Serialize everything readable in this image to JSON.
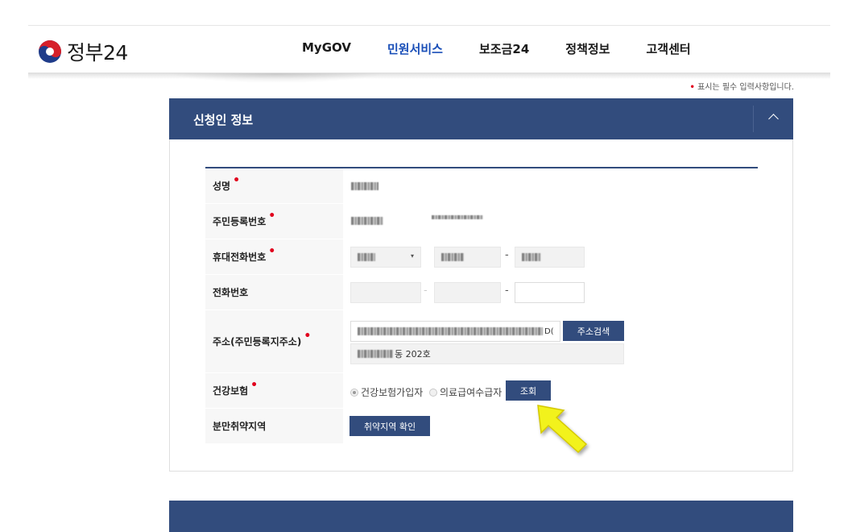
{
  "header": {
    "logo_text": "정부24",
    "nav": [
      "MyGOV",
      "민원서비스",
      "보조금24",
      "정책정보",
      "고객센터"
    ],
    "active_nav_index": 1
  },
  "required_note": "표시는 필수 입력사항입니다.",
  "panel": {
    "title": "신청인 정보",
    "toggle_icon": "chevron-up-icon"
  },
  "form": {
    "name_label": "성명",
    "rrn_label": "주민등록번호",
    "mobile_label": "휴대전화번호",
    "phone_label": "전화번호",
    "phone_dash": "-",
    "address_label": "주소(주민등록지주소)",
    "address_search_button": "주소검색",
    "address_detail_suffix": "동 202호",
    "address_line1_tail": "D(",
    "health_label": "건강보험",
    "health_options": [
      "건강보험가입자",
      "의료급여수급자"
    ],
    "health_selected_index": 0,
    "health_lookup_button": "조회",
    "region_label": "분만취약지역",
    "region_button": "취약지역 확인"
  },
  "colors": {
    "accent": "#324c7d",
    "nav_active": "#1a4fb8",
    "required": "#e1001d",
    "pointer_arrow": "#f2f21e"
  }
}
